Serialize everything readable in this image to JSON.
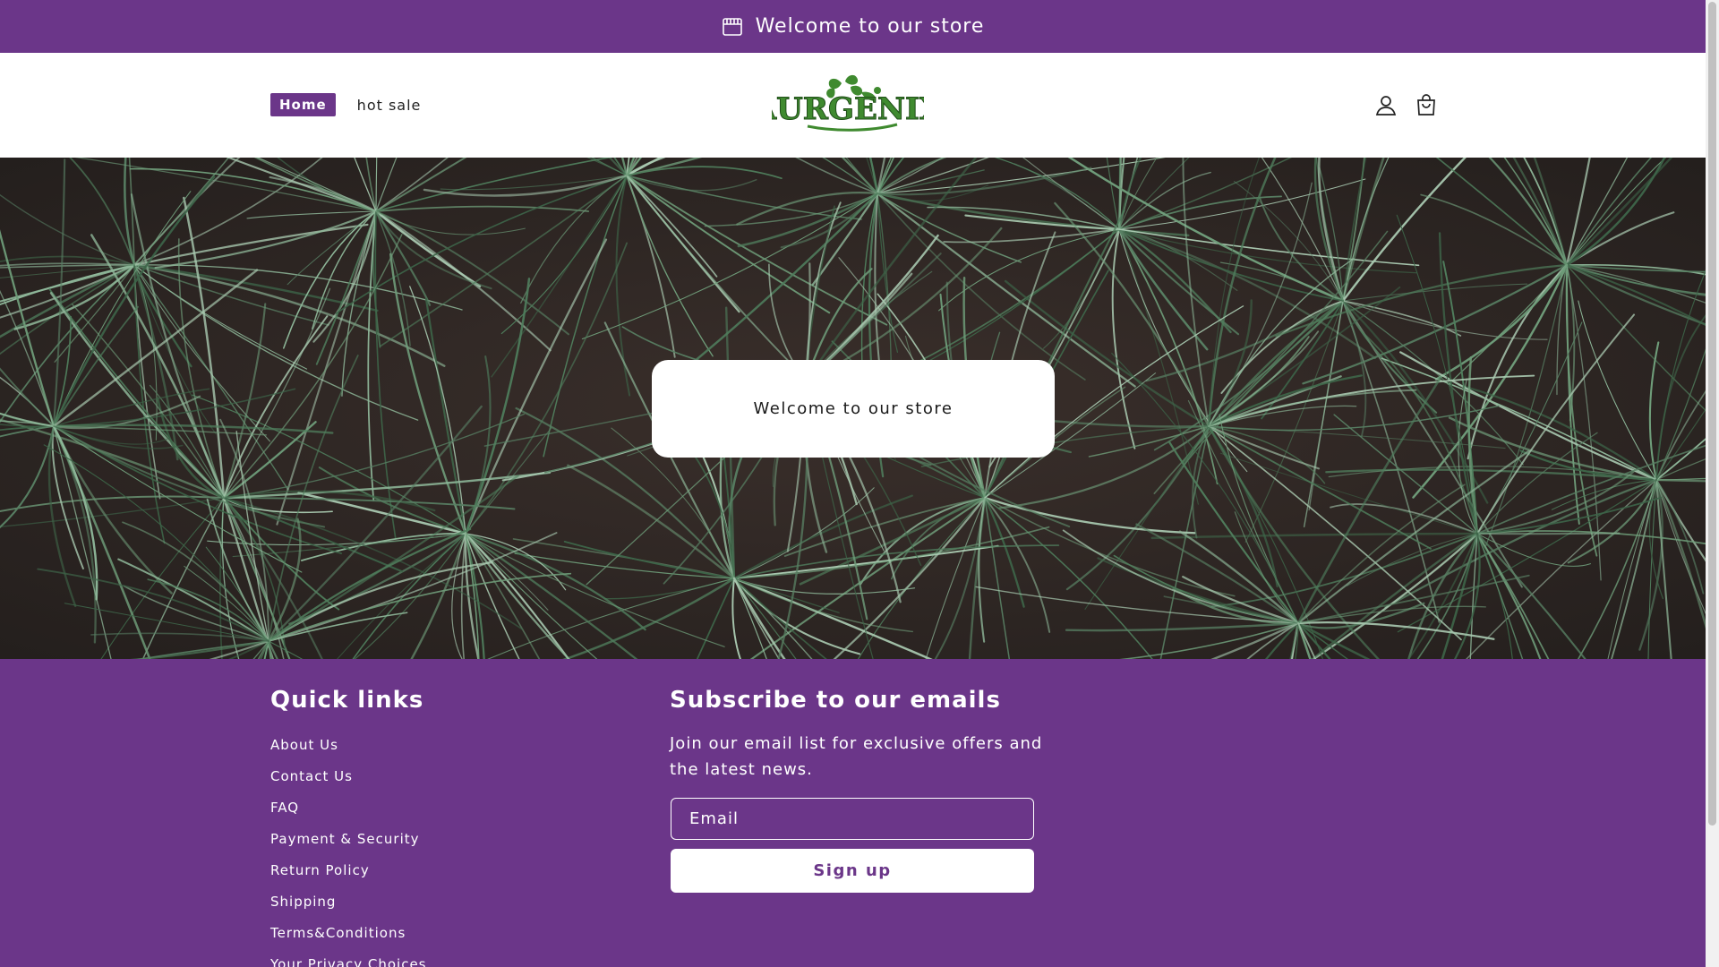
{
  "announcement": {
    "text": "Welcome to our store",
    "icon": "store-icon"
  },
  "header": {
    "nav": [
      {
        "label": "Home",
        "active": true
      },
      {
        "label": "hot sale",
        "active": false
      }
    ],
    "logo_text": "AURGENIX",
    "icons": [
      "account-icon",
      "cart-icon"
    ]
  },
  "hero": {
    "card_text": "Welcome to our store"
  },
  "footer": {
    "quick_links_title": "Quick links",
    "quick_links": [
      "About Us",
      "Contact Us",
      "FAQ",
      "Payment & Security",
      "Return Policy",
      "Shipping",
      "Terms&Conditions",
      "Your Privacy Choices"
    ],
    "subscribe_title": "Subscribe to our emails",
    "subscribe_text": "Join our email list for exclusive offers and the latest news.",
    "email_placeholder": "Email",
    "signup_label": "Sign up"
  },
  "colors": {
    "brand": "#6b3689",
    "logo_green": "#3f8a2f"
  }
}
